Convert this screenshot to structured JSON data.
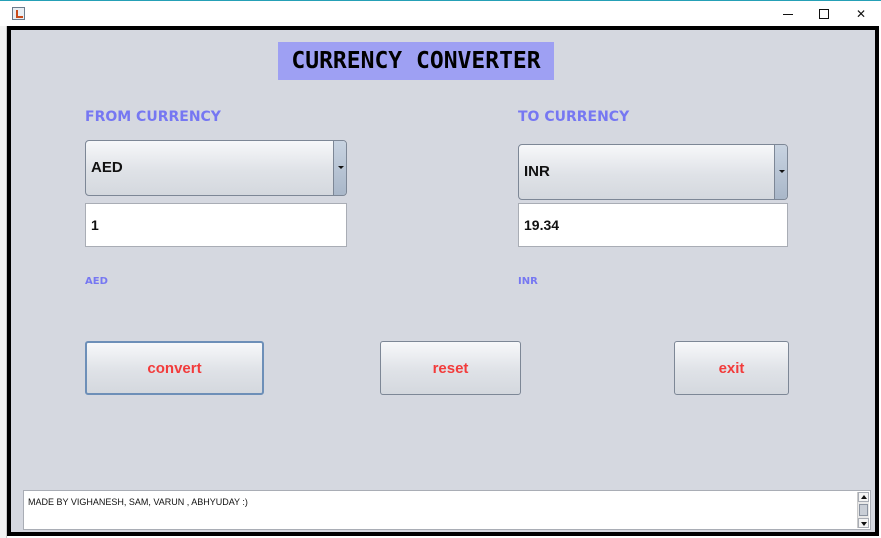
{
  "window": {
    "minimize_label": "–",
    "maximize_label": "☐",
    "close_label": "✕",
    "icons": [
      "app-icon",
      "minimize-icon",
      "maximize-icon",
      "close-icon"
    ]
  },
  "app": {
    "title": "CURRENCY CONVERTER"
  },
  "from": {
    "label": "FROM CURRENCY",
    "selected": "AED",
    "amount": "1",
    "code": "AED"
  },
  "to": {
    "label": "TO CURRENCY",
    "selected": "INR",
    "amount": "19.34",
    "code": "INR"
  },
  "buttons": {
    "convert": "convert",
    "reset": "reset",
    "exit": "exit"
  },
  "footer": {
    "text": "MADE BY VIGHANESH, SAM, VARUN , ABHYUDAY :)"
  },
  "colors": {
    "title_bg": "#9ea0f3",
    "label": "#7677f2",
    "button_text": "#f23b3b",
    "panel_bg": "#d5d8e0",
    "frame_border": "#000000"
  }
}
